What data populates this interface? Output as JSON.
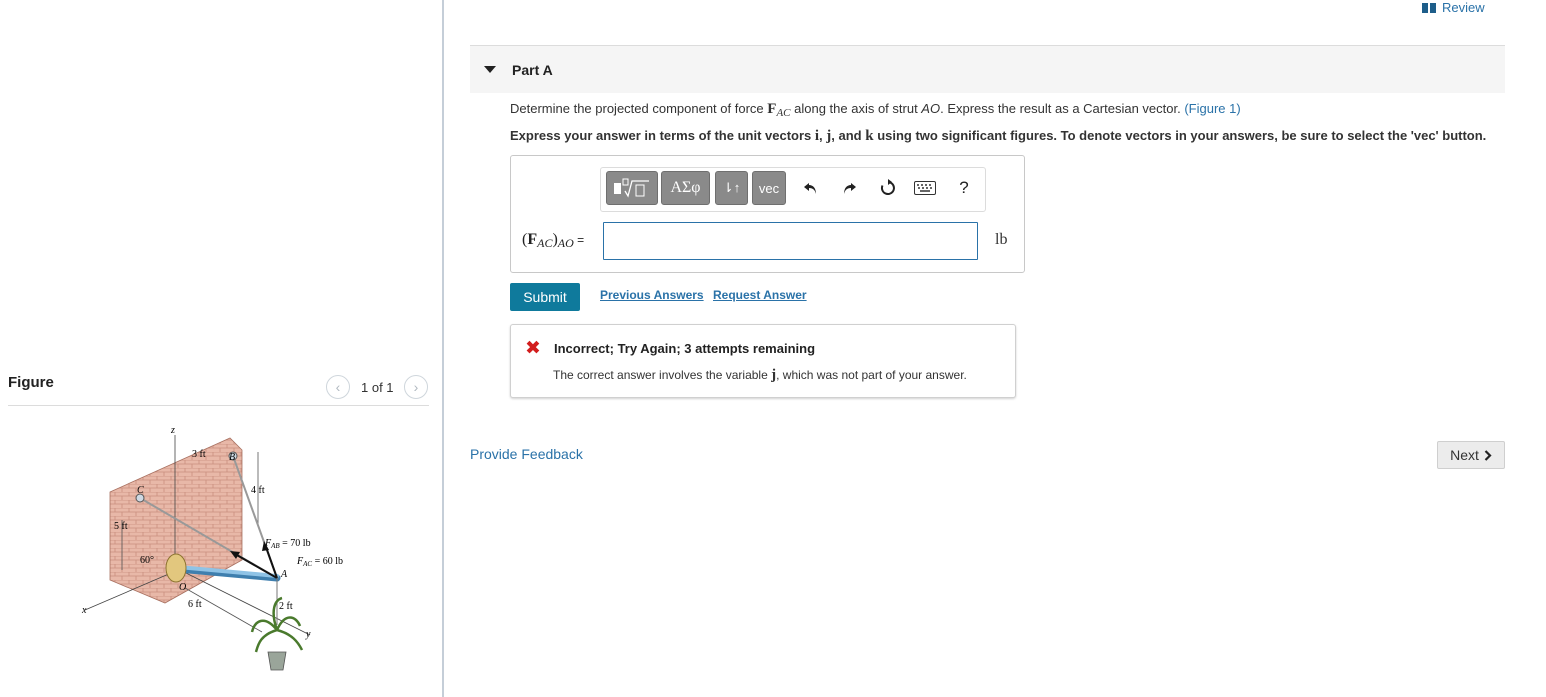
{
  "review": {
    "label": "Review",
    "icon": "book-icon"
  },
  "part": {
    "title": "Part A"
  },
  "question": {
    "before": "Determine the projected component of force ",
    "force_symbol": "F",
    "force_sub": "AC",
    "middle": " along the axis of strut ",
    "strut": "AO",
    "after": ". Express the result as a Cartesian vector. ",
    "figure_link": "(Figure 1)"
  },
  "instruction": {
    "part1": "Express your answer in terms of the unit vectors ",
    "i": "i",
    "sep1": ", ",
    "j": "j",
    "sep2": ", and ",
    "k": "k",
    "part2": " using two significant figures. To denote vectors in your answers, be sure to select the 'vec' button."
  },
  "toolbar": {
    "greek_label": "ΑΣφ",
    "updown_label": "⇂↑",
    "vec_label": "vec",
    "help_label": "?"
  },
  "answer": {
    "label_open": "(",
    "label_bold": "F",
    "label_sub": "AC",
    "label_close": ")",
    "label_sub2": "AO",
    "label_eq": " =",
    "value": "",
    "unit": "lb"
  },
  "actions": {
    "submit": "Submit",
    "previous_answers": "Previous Answers",
    "request_answer": "Request Answer"
  },
  "feedback": {
    "title": "Incorrect; Try Again; 3 attempts remaining",
    "body_before": "The correct answer involves the variable ",
    "variable": "j",
    "body_after": ", which was not part of your answer."
  },
  "footer": {
    "provide_feedback": "Provide Feedback",
    "next": "Next"
  },
  "figure_panel": {
    "title": "Figure",
    "counter": "1 of 1",
    "labels": {
      "z": "z",
      "three_ft": "3 ft",
      "b": "B",
      "four_ft": "4 ft",
      "c": "C",
      "five_ft": "5 ft",
      "fab": "F",
      "fab_sub": "AB",
      "fab_val": " = 70 lb",
      "fac": "F",
      "fac_sub": "AC",
      "fac_val": " = 60 lb",
      "sixty": "60°",
      "o": "O",
      "a": "A",
      "x": "x",
      "six_ft": "6 ft",
      "two_ft": "2 ft",
      "y": "y"
    }
  },
  "colors": {
    "link": "#2a72a8",
    "submit_bg": "#0f7a9c",
    "error": "#d21d1d",
    "brick": "#e8b8a8",
    "strut": "#8fc3e6"
  }
}
